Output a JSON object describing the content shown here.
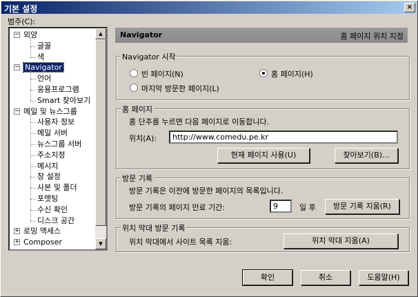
{
  "window": {
    "title": "기본 설정",
    "close_glyph": "×"
  },
  "category_label": "범주(C):",
  "tree": {
    "items": [
      {
        "label": "외양",
        "level": 0,
        "expander": "−"
      },
      {
        "label": "글꼴",
        "level": 1
      },
      {
        "label": "색",
        "level": 1
      },
      {
        "label": "Navigator",
        "level": 0,
        "expander": "−",
        "selected": true
      },
      {
        "label": "언어",
        "level": 1
      },
      {
        "label": "응용프로그램",
        "level": 1
      },
      {
        "label": "Smart 찾아보기",
        "level": 1
      },
      {
        "label": "메일 및 뉴스그룹",
        "level": 0,
        "expander": "−"
      },
      {
        "label": "사용자 정보",
        "level": 1
      },
      {
        "label": "메일 서버",
        "level": 1
      },
      {
        "label": "뉴스그룹 서버",
        "level": 1
      },
      {
        "label": "주소지정",
        "level": 1
      },
      {
        "label": "메시지",
        "level": 1
      },
      {
        "label": "창 설정",
        "level": 1
      },
      {
        "label": "사본 및 폴더",
        "level": 1
      },
      {
        "label": "포맷팅",
        "level": 1
      },
      {
        "label": "수신 확인",
        "level": 1
      },
      {
        "label": "디스크 공간",
        "level": 1
      },
      {
        "label": "로밍 액세스",
        "level": 0,
        "expander": "+"
      },
      {
        "label": "Composer",
        "level": 0,
        "expander": "+"
      }
    ],
    "scroll_up": "▲",
    "scroll_down": "▼"
  },
  "panel": {
    "title": "Navigator",
    "subtitle": "홈 페이지 위치 지정"
  },
  "start_group": {
    "legend": "Navigator 시작",
    "options": [
      {
        "label": "빈 페이지(N)",
        "checked": false
      },
      {
        "label": "홈 페이지(H)",
        "checked": true
      },
      {
        "label": "마지막 방문한 페이지(L)",
        "checked": false
      }
    ]
  },
  "home_group": {
    "legend": "홈 페이지",
    "desc": "홈 단추를 누르면 다음 페이지로 이동합니다.",
    "location_label": "위치(A):",
    "location_value": "http://www.comedu.pe.kr",
    "use_current": "현재 페이지 사용(U)",
    "browse": "찾아보기(B)..."
  },
  "history_group": {
    "legend": "방문 기록",
    "desc": "방문 기록은 이전에 방문한 페이지의 목록입니다.",
    "expire_label": "방문 기록의 페이지 만료 기간:",
    "expire_value": "9",
    "days_label": "일 후",
    "clear": "방문 기록 지움(R)"
  },
  "locbar_group": {
    "legend": "위치 막대 방문 기록",
    "desc": "위치 막대에서 사이트 목록 지움:",
    "clear": "위치 막대 지움(A)"
  },
  "footer": {
    "ok": "확인",
    "cancel": "취소",
    "help": "도움말(H)"
  }
}
